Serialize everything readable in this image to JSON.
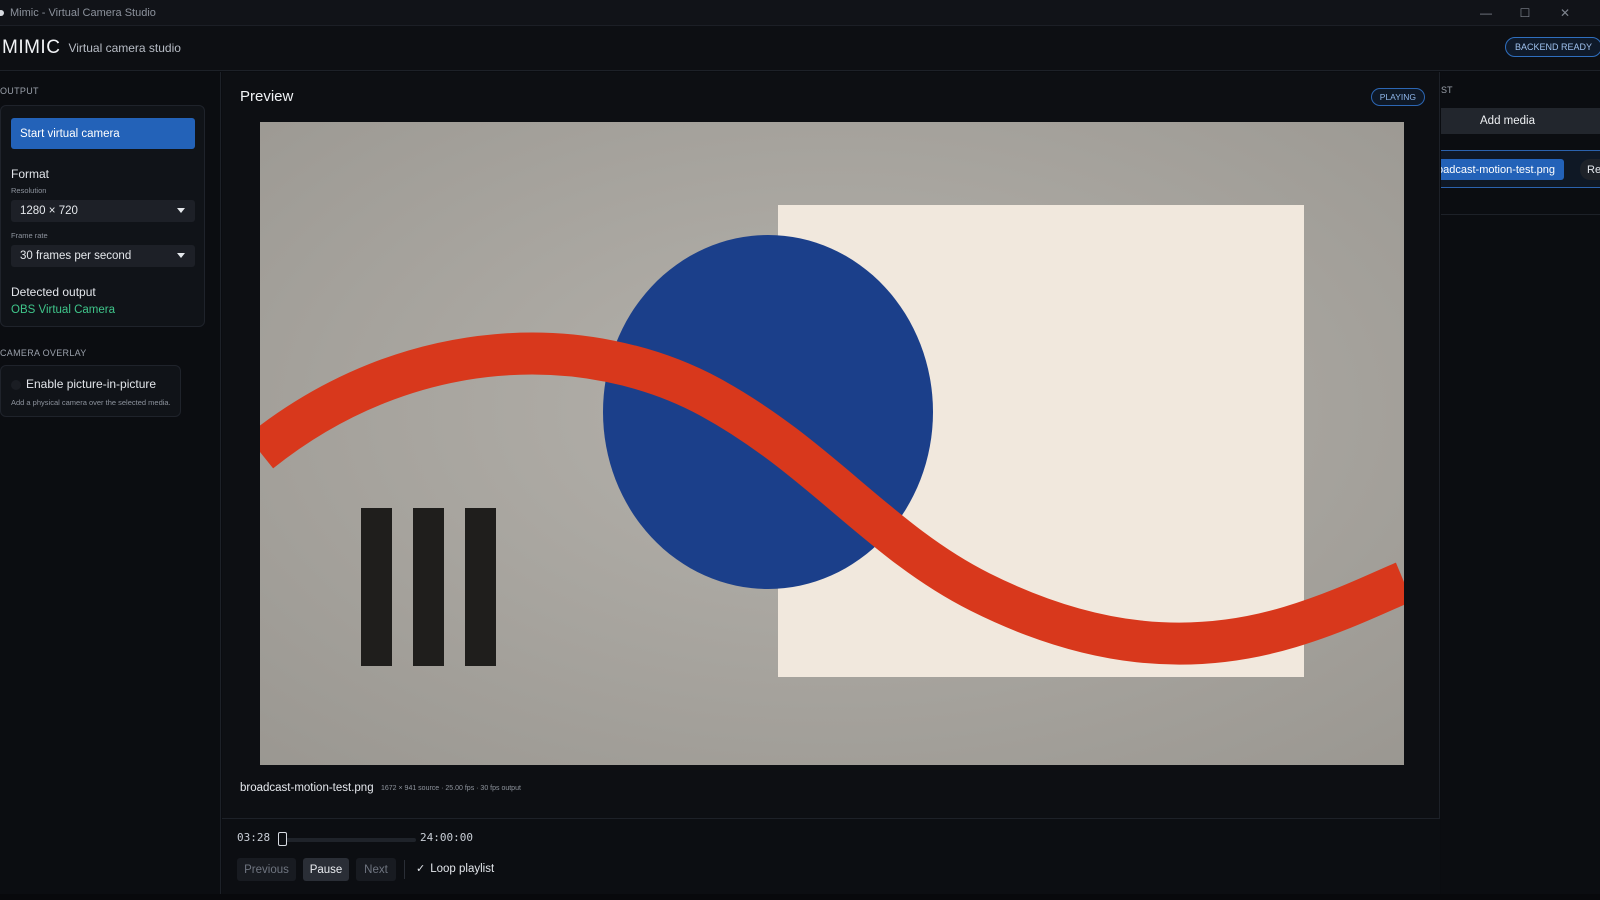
{
  "window": {
    "title": "Mimic - Virtual Camera Studio",
    "minimize_glyph": "—",
    "maximize_glyph": "☐",
    "close_glyph": "✕"
  },
  "header": {
    "brand": "MIMIC",
    "tagline": "Virtual camera studio",
    "status_badge": "BACKEND READY"
  },
  "sidebar": {
    "output_section_label": "OUTPUT",
    "start_button": "Start virtual camera",
    "format_title": "Format",
    "resolution_label": "Resolution",
    "resolution_value": "1280 × 720",
    "framerate_label": "Frame rate",
    "framerate_value": "30 frames per second",
    "detected_title": "Detected output",
    "detected_value": "OBS Virtual Camera",
    "overlay_section_label": "CAMERA OVERLAY",
    "pip_label": "Enable picture-in-picture",
    "pip_hint": "Add a physical camera over the selected media."
  },
  "main": {
    "title": "Preview",
    "status_badge": "PLAYING",
    "media_name": "broadcast-motion-test.png",
    "media_meta": "1672 × 941 source · 25.00 fps · 30 fps output",
    "transport": {
      "elapsed": "03:28",
      "duration": "24:00:00",
      "progress_fraction": 0.0024,
      "previous": "Previous",
      "pause": "Pause",
      "next": "Next",
      "loop_check": "✓",
      "loop_label": "Loop playlist"
    }
  },
  "right_panel": {
    "section_label": "ST",
    "add_media": "Add media",
    "playlist_item": "oadcast-motion-test.png",
    "remove_button": "Re"
  },
  "colors": {
    "accent_blue": "#2362b8",
    "success_green": "#3fc58a",
    "artwork_red": "#d8381c",
    "artwork_navy": "#1b3f8a"
  }
}
